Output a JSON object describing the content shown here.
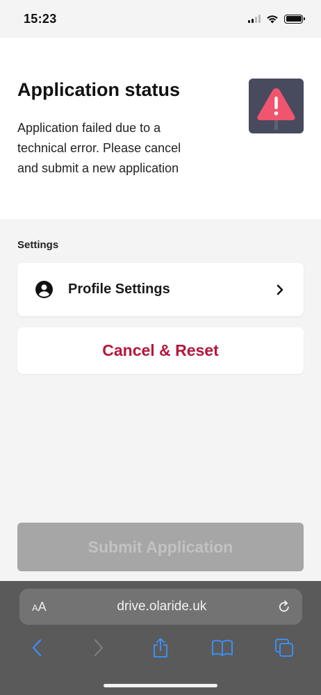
{
  "status_bar": {
    "time": "15:23"
  },
  "application": {
    "title": "Application status",
    "message": "Application failed due to a technical error. Please cancel and submit a new application",
    "icon": "warning-icon"
  },
  "settings": {
    "section_label": "Settings",
    "profile_label": "Profile Settings",
    "profile_icon": "account-circle-icon",
    "cancel_label": "Cancel & Reset"
  },
  "submit": {
    "label": "Submit Application",
    "disabled": true
  },
  "browser": {
    "aa_label": "AA",
    "url": "drive.olaride.uk"
  },
  "colors": {
    "accent_red": "#b3173c",
    "warning_tile": "#484a5e",
    "warning_triangle": "#f0556f",
    "browser_blue": "#3d8ef0"
  }
}
